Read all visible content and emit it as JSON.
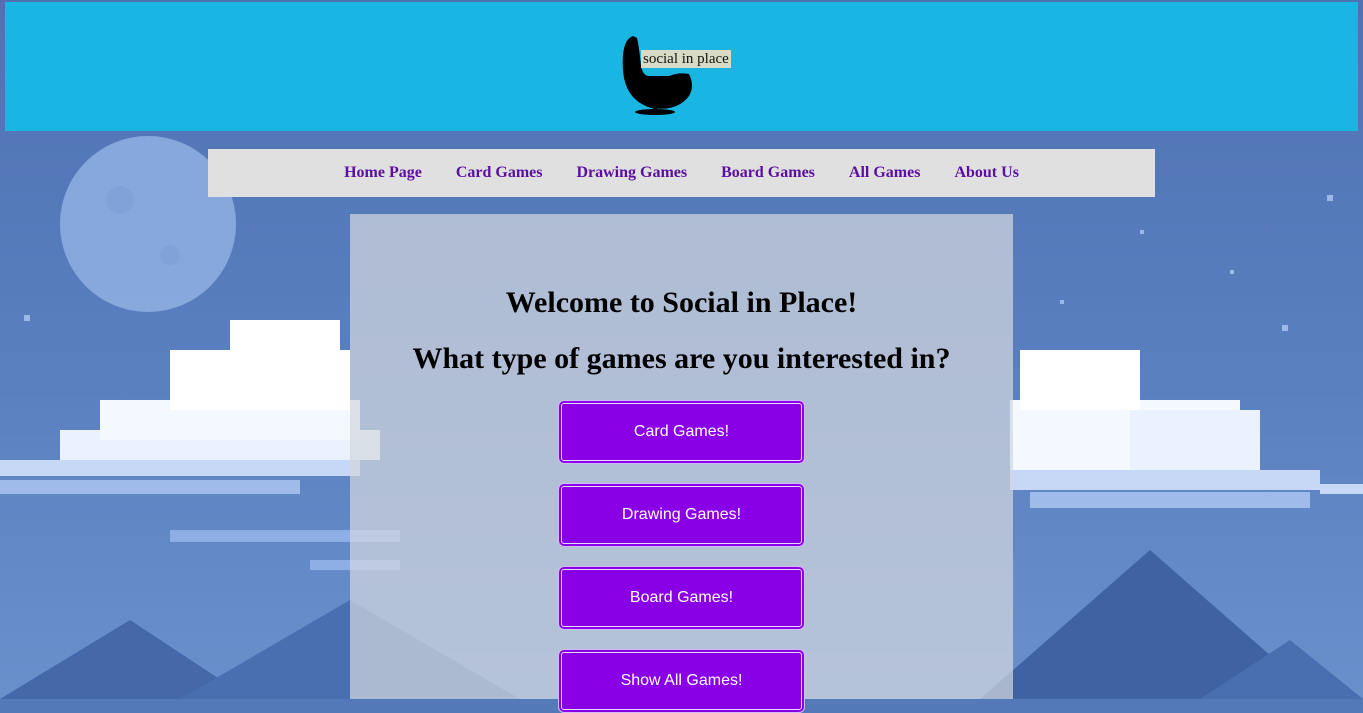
{
  "header": {
    "logo_text": "social in place",
    "background": "#1ab6e3"
  },
  "nav": {
    "items": [
      {
        "label": "Home Page"
      },
      {
        "label": "Card Games"
      },
      {
        "label": "Drawing Games"
      },
      {
        "label": "Board Games"
      },
      {
        "label": "All Games"
      },
      {
        "label": "About Us"
      }
    ],
    "link_color": "#5a0fa0"
  },
  "main": {
    "welcome": "Welcome to Social in Place!",
    "question": "What type of games are you interested in?",
    "buttons": [
      {
        "label": "Card Games!"
      },
      {
        "label": "Drawing Games!"
      },
      {
        "label": "Board Games!"
      },
      {
        "label": "Show All Games!"
      }
    ],
    "button_color": "#8a00e6"
  },
  "icons": {
    "logo": "egg-chair-icon"
  }
}
